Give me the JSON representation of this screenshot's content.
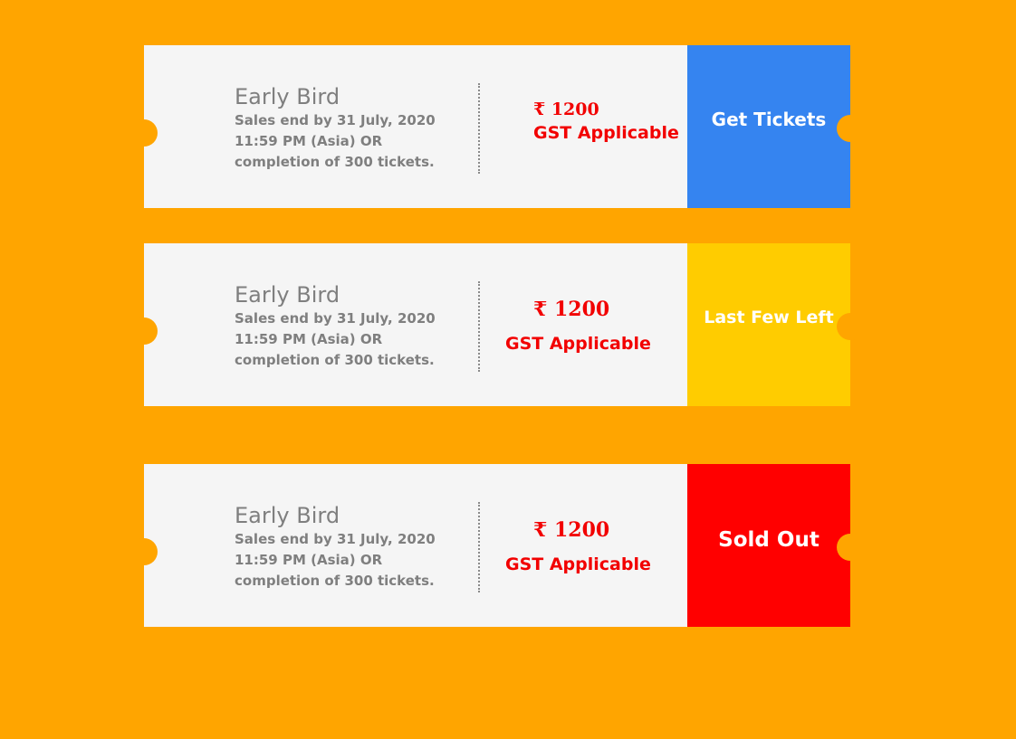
{
  "tickets": [
    {
      "title": "Early Bird",
      "desc_line1": "Sales end by 31 July, 2020",
      "desc_line2": "11:59 PM (Asia) OR",
      "desc_line3": "completion of 300 tickets.",
      "price": "₹ 1200",
      "gst": "GST Applicable",
      "action_label": "Get Tickets",
      "action_color": "#3584f0"
    },
    {
      "title": "Early Bird",
      "desc_line1": "Sales end by 31 July, 2020",
      "desc_line2": "11:59 PM (Asia) OR",
      "desc_line3": "completion of 300 tickets.",
      "price": "₹ 1200",
      "gst": "GST Applicable",
      "action_label": "Last Few Left",
      "action_color": "#ffcc00"
    },
    {
      "title": "Early Bird",
      "desc_line1": "Sales end by 31 July, 2020",
      "desc_line2": "11:59 PM (Asia) OR",
      "desc_line3": "completion of 300 tickets.",
      "price": "₹ 1200",
      "gst": "GST Applicable",
      "action_label": "Sold Out",
      "action_color": "#ff0000"
    }
  ],
  "colors": {
    "background": "#ffa500",
    "ticket_body": "#f5f5f5",
    "text_gray": "#7f7f7f",
    "price_red": "#f20000"
  }
}
